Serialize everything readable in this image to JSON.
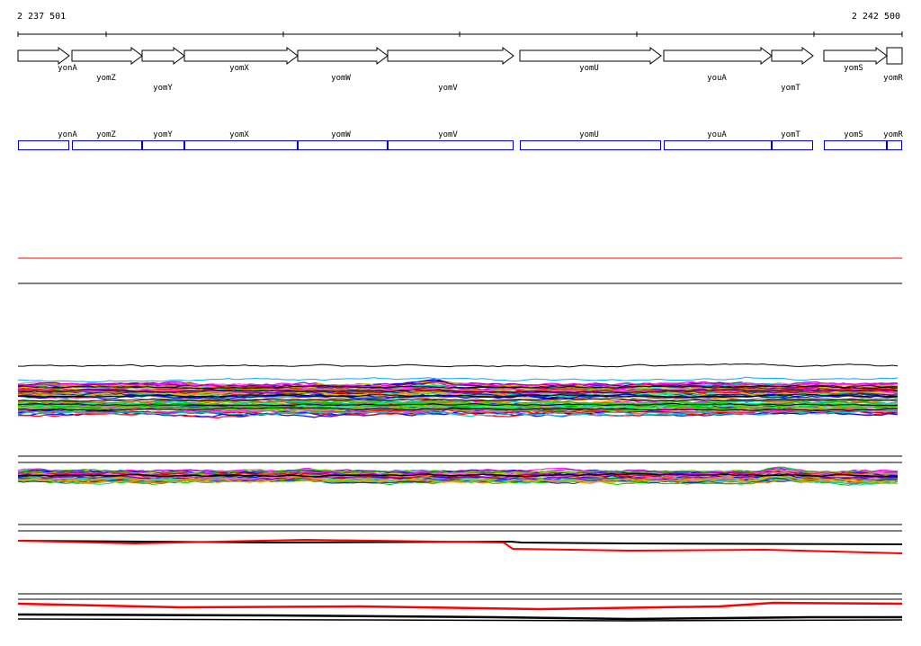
{
  "region": {
    "start_label": "2 237 501",
    "end_label": "2 242 500"
  },
  "genes": [
    {
      "name": "yonA",
      "strand": "+"
    },
    {
      "name": "yomZ",
      "strand": "+"
    },
    {
      "name": "yomY",
      "strand": "+"
    },
    {
      "name": "yomX",
      "strand": "+"
    },
    {
      "name": "yomW",
      "strand": "+"
    },
    {
      "name": "yomV",
      "strand": "+"
    },
    {
      "name": "yomU",
      "strand": "+"
    },
    {
      "name": "youA",
      "strand": "+"
    },
    {
      "name": "yomT",
      "strand": "+"
    },
    {
      "name": "yomS",
      "strand": "+"
    },
    {
      "name": "yomR",
      "strand": "+"
    }
  ],
  "colors": {
    "gene_outline": "#000000",
    "annotation_box": "#0000cc",
    "annotation_text": "#000000",
    "highlight_red": "#ff0000",
    "track_border": "#000000",
    "palette": [
      "#ff00ff",
      "#00cc00",
      "#ff0000",
      "#0000ff",
      "#00cccc",
      "#cc6600",
      "#888888",
      "#9900cc",
      "#66cc00",
      "#ff66cc",
      "#003399",
      "#cccc00",
      "#ff9900",
      "#00ff99",
      "#660066"
    ]
  },
  "tracks": [
    {
      "name": "threshold-track",
      "type": "lines"
    },
    {
      "name": "expression-profiles-track",
      "type": "profiles"
    },
    {
      "name": "secondary-profiles-track",
      "type": "profiles"
    },
    {
      "name": "red-black-track-1",
      "type": "profiles"
    },
    {
      "name": "red-black-track-2",
      "type": "profiles"
    }
  ]
}
